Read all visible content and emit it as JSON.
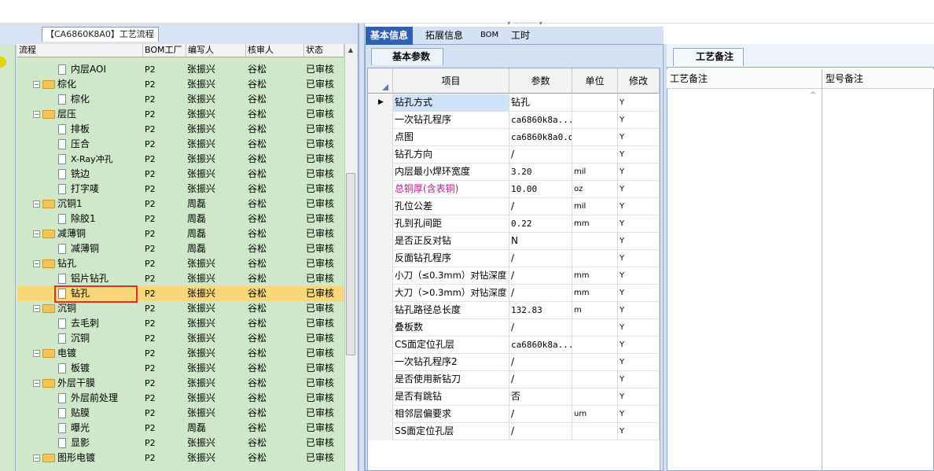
{
  "left_panel": {
    "tab_label": "【CA6860K8A0】工艺流程",
    "columns": [
      "流程",
      "BOM工厂",
      "编写人",
      "核审人",
      "状态"
    ],
    "rows": [
      {
        "name": "内层AOI",
        "level": 2,
        "type": "doc",
        "plant": "P2",
        "author": "张振兴",
        "reviewer": "谷松",
        "status": "已审核"
      },
      {
        "name": "棕化",
        "level": 1,
        "type": "folder",
        "plant": "P2",
        "author": "张振兴",
        "reviewer": "谷松",
        "status": "已审核"
      },
      {
        "name": "棕化",
        "level": 2,
        "type": "doc",
        "plant": "P2",
        "author": "张振兴",
        "reviewer": "谷松",
        "status": "已审核"
      },
      {
        "name": "层压",
        "level": 1,
        "type": "folder",
        "plant": "P2",
        "author": "张振兴",
        "reviewer": "谷松",
        "status": "已审核"
      },
      {
        "name": "排板",
        "level": 2,
        "type": "doc",
        "plant": "P2",
        "author": "张振兴",
        "reviewer": "谷松",
        "status": "已审核"
      },
      {
        "name": "压合",
        "level": 2,
        "type": "doc",
        "plant": "P2",
        "author": "张振兴",
        "reviewer": "谷松",
        "status": "已审核"
      },
      {
        "name": "X-Ray冲孔",
        "level": 2,
        "type": "doc",
        "plant": "P2",
        "author": "张振兴",
        "reviewer": "谷松",
        "status": "已审核"
      },
      {
        "name": "铣边",
        "level": 2,
        "type": "doc",
        "plant": "P2",
        "author": "张振兴",
        "reviewer": "谷松",
        "status": "已审核"
      },
      {
        "name": "打字唛",
        "level": 2,
        "type": "doc",
        "plant": "P2",
        "author": "张振兴",
        "reviewer": "谷松",
        "status": "已审核"
      },
      {
        "name": "沉铜1",
        "level": 1,
        "type": "folder",
        "plant": "P2",
        "author": "周磊",
        "reviewer": "谷松",
        "status": "已审核"
      },
      {
        "name": "除胶1",
        "level": 2,
        "type": "doc",
        "plant": "P2",
        "author": "周磊",
        "reviewer": "谷松",
        "status": "已审核"
      },
      {
        "name": "减薄铜",
        "level": 1,
        "type": "folder",
        "plant": "P2",
        "author": "周磊",
        "reviewer": "谷松",
        "status": "已审核"
      },
      {
        "name": "减薄铜",
        "level": 2,
        "type": "doc",
        "plant": "P2",
        "author": "周磊",
        "reviewer": "谷松",
        "status": "已审核"
      },
      {
        "name": "钻孔",
        "level": 1,
        "type": "folder",
        "plant": "P2",
        "author": "张振兴",
        "reviewer": "谷松",
        "status": "已审核"
      },
      {
        "name": "铝片钻孔",
        "level": 2,
        "type": "doc",
        "plant": "P2",
        "author": "张振兴",
        "reviewer": "谷松",
        "status": "已审核"
      },
      {
        "name": "钻孔",
        "level": 2,
        "type": "doc",
        "plant": "P2",
        "author": "张振兴",
        "reviewer": "谷松",
        "status": "已审核",
        "selected": true
      },
      {
        "name": "沉铜",
        "level": 1,
        "type": "folder",
        "plant": "P2",
        "author": "张振兴",
        "reviewer": "谷松",
        "status": "已审核"
      },
      {
        "name": "去毛刺",
        "level": 2,
        "type": "doc",
        "plant": "P2",
        "author": "张振兴",
        "reviewer": "谷松",
        "status": "已审核"
      },
      {
        "name": "沉铜",
        "level": 2,
        "type": "doc",
        "plant": "P2",
        "author": "张振兴",
        "reviewer": "谷松",
        "status": "已审核"
      },
      {
        "name": "电镀",
        "level": 1,
        "type": "folder",
        "plant": "P2",
        "author": "张振兴",
        "reviewer": "谷松",
        "status": "已审核"
      },
      {
        "name": "板镀",
        "level": 2,
        "type": "doc",
        "plant": "P2",
        "author": "张振兴",
        "reviewer": "谷松",
        "status": "已审核"
      },
      {
        "name": "外层干膜",
        "level": 1,
        "type": "folder",
        "plant": "P2",
        "author": "张振兴",
        "reviewer": "谷松",
        "status": "已审核"
      },
      {
        "name": "外层前处理",
        "level": 2,
        "type": "doc",
        "plant": "P2",
        "author": "张振兴",
        "reviewer": "谷松",
        "status": "已审核"
      },
      {
        "name": "贴膜",
        "level": 2,
        "type": "doc",
        "plant": "P2",
        "author": "张振兴",
        "reviewer": "谷松",
        "status": "已审核"
      },
      {
        "name": "曝光",
        "level": 2,
        "type": "doc",
        "plant": "P2",
        "author": "周磊",
        "reviewer": "谷松",
        "status": "已审核"
      },
      {
        "name": "显影",
        "level": 2,
        "type": "doc",
        "plant": "P2",
        "author": "张振兴",
        "reviewer": "谷松",
        "status": "已审核"
      },
      {
        "name": "图形电镀",
        "level": 1,
        "type": "folder",
        "plant": "P2",
        "author": "张振兴",
        "reviewer": "谷松",
        "status": "已审核"
      }
    ]
  },
  "middle_panel": {
    "tabs": [
      "基本信息",
      "拓展信息",
      "BOM",
      "工时"
    ],
    "subtab": "基本参数",
    "columns": [
      "项目",
      "参数",
      "单位",
      "修改"
    ],
    "rows": [
      {
        "item": "钻孔方式",
        "value": "钻孔",
        "unit": "",
        "mod": "Y",
        "current": true
      },
      {
        "item": "一次钻孔程序",
        "value": "ca6860k8a...",
        "unit": "",
        "mod": "Y"
      },
      {
        "item": "点图",
        "value": "ca6860k8a0.d",
        "unit": "",
        "mod": "Y"
      },
      {
        "item": "钻孔方向",
        "value": "/",
        "unit": "",
        "mod": "Y"
      },
      {
        "item": "内层最小焊环宽度",
        "value": "3.20",
        "unit": "mil",
        "mod": "Y"
      },
      {
        "item": "总铜厚(含表铜)",
        "value": "10.00",
        "unit": "oz",
        "mod": "Y",
        "highlight": true
      },
      {
        "item": "孔位公差",
        "value": "/",
        "unit": "mil",
        "mod": "Y"
      },
      {
        "item": "孔到孔间距",
        "value": "0.22",
        "unit": "mm",
        "mod": "Y"
      },
      {
        "item": "是否正反对钻",
        "value": "N",
        "unit": "",
        "mod": "Y"
      },
      {
        "item": "反面钻孔程序",
        "value": "/",
        "unit": "",
        "mod": "Y"
      },
      {
        "item": "小刀（≤0.3mm）对钻深度",
        "value": "/",
        "unit": "mm",
        "mod": "Y"
      },
      {
        "item": "大刀（>0.3mm）对钻深度",
        "value": "/",
        "unit": "mm",
        "mod": "Y"
      },
      {
        "item": "钻孔路径总长度",
        "value": "132.83",
        "unit": "m",
        "mod": "Y"
      },
      {
        "item": "叠板数",
        "value": "/",
        "unit": "",
        "mod": "Y"
      },
      {
        "item": "CS面定位孔层",
        "value": "ca6860k8a...",
        "unit": "",
        "mod": "Y"
      },
      {
        "item": "一次钻孔程序2",
        "value": "/",
        "unit": "",
        "mod": "Y"
      },
      {
        "item": "是否使用新钻刀",
        "value": "/",
        "unit": "",
        "mod": "Y"
      },
      {
        "item": "是否有跳钻",
        "value": "否",
        "unit": "",
        "mod": "Y"
      },
      {
        "item": "相邻层偏要求",
        "value": "/",
        "unit": "um",
        "mod": "Y"
      },
      {
        "item": "SS面定位孔层",
        "value": "/",
        "unit": "",
        "mod": "Y"
      }
    ]
  },
  "right_panel": {
    "tab": "工艺备注",
    "columns": [
      "工艺备注",
      "型号备注"
    ]
  },
  "colors": {
    "selected_row": "#f8d77a",
    "tree_bg": "#cfe8c9",
    "tab_active": "#2e62b0",
    "highlight_text": "#c0188c",
    "selection_box": "#e03020"
  }
}
